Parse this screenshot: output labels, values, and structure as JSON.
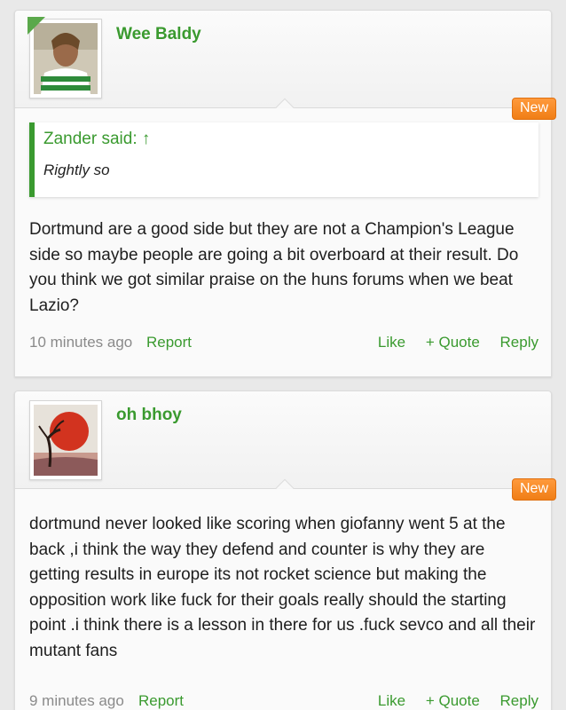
{
  "posts": [
    {
      "username": "Wee Baldy",
      "avatar": "user-avatar-green-shirt",
      "badge": "New",
      "quote": {
        "author": "Zander said: ↑",
        "text": "Rightly so"
      },
      "message": "Dortmund are a good side but they are not a Champion's League side so maybe people are going a bit overboard at their result. Do you think we got similar praise on the huns forums when we beat Lazio?",
      "time": "10 minutes ago",
      "actions": {
        "report": "Report",
        "like": "Like",
        "quote": "+ Quote",
        "reply": "Reply"
      }
    },
    {
      "username": "oh bhoy",
      "avatar": "user-avatar-red-sun-tree",
      "badge": "New",
      "message": "dortmund never looked like scoring when giofanny went 5 at the back ,i think the way they defend and counter is why they are getting results in europe its not rocket science but making the opposition work like fuck for their goals really should the starting point .i think there is a lesson in there for us .fuck sevco and all their mutant fans",
      "time": "9 minutes ago",
      "actions": {
        "report": "Report",
        "like": "Like",
        "quote": "+ Quote",
        "reply": "Reply"
      }
    }
  ],
  "colors": {
    "accent": "#3a9a2f",
    "badge": "#f58a22",
    "muted": "#8a8a8a"
  }
}
